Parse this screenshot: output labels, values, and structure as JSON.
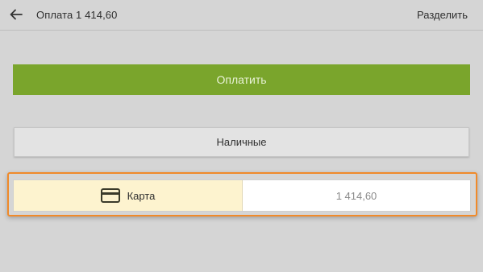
{
  "header": {
    "back_icon": "arrow-left-icon",
    "title": "Оплата 1 414,60",
    "split_label": "Разделить"
  },
  "actions": {
    "pay_label": "Оплатить",
    "cash_label": "Наличные"
  },
  "payment_method": {
    "icon": "credit-card-icon",
    "label": "Карта",
    "amount": "1 414,60"
  },
  "colors": {
    "background": "#d5d5d5",
    "pay_button": "#7aa52c",
    "selected_method_bg": "#fdf3cf",
    "focus_outline": "#f08a2a"
  }
}
